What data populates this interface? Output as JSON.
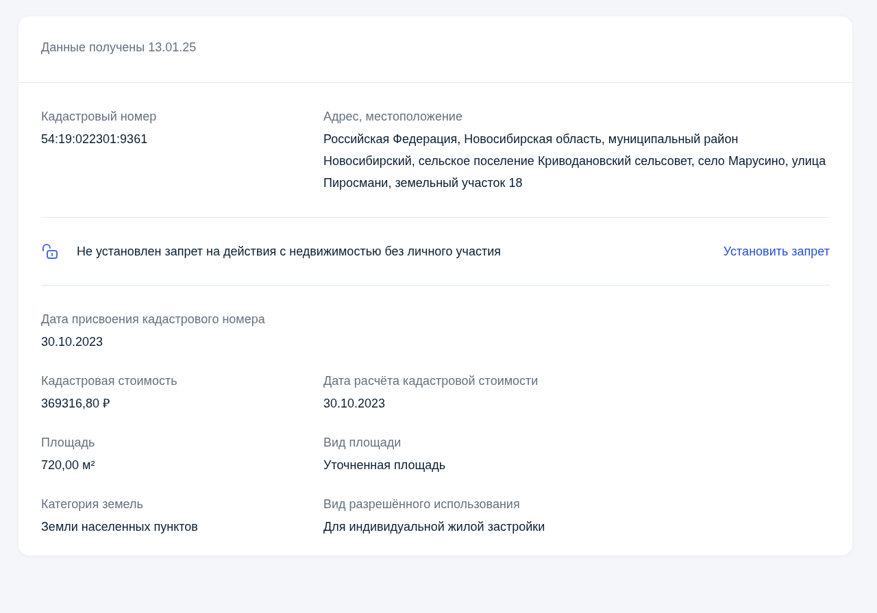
{
  "header": {
    "text": "Данные получены 13.01.25"
  },
  "top_fields": [
    {
      "label": "Кадастровый номер",
      "value": "54:19:022301:9361"
    },
    {
      "label": "Адрес, местоположение",
      "value": "Российская Федерация, Новосибирская область, муниципальный район Новосибирский, сельское поселение Криводановский сельсовет, село Марусино, улица Пиросмани, земельный участок 18"
    }
  ],
  "notice": {
    "text": "Не установлен запрет на действия с недвижимостью без личного участия",
    "link": "Установить запрет"
  },
  "rows": [
    [
      {
        "label": "Дата присвоения кадастрового номера",
        "value": "30.10.2023"
      }
    ],
    [
      {
        "label": "Кадастровая стоимость",
        "value": "369316,80 ₽"
      },
      {
        "label": "Дата расчёта кадастровой стоимости",
        "value": "30.10.2023"
      }
    ],
    [
      {
        "label": "Площадь",
        "value": "720,00 м²"
      },
      {
        "label": "Вид площади",
        "value": "Уточненная площадь"
      }
    ],
    [
      {
        "label": "Категория земель",
        "value": "Земли населенных пунктов"
      },
      {
        "label": "Вид разрешённого использования",
        "value": "Для индивидуальной жилой застройки"
      }
    ]
  ]
}
